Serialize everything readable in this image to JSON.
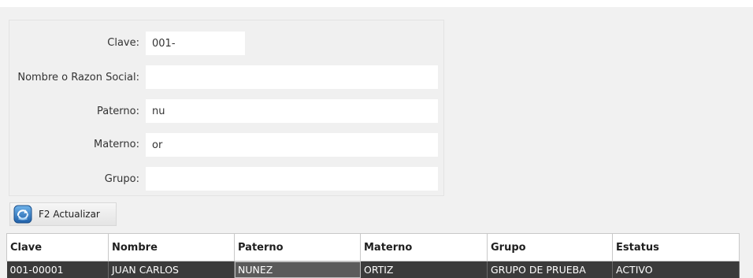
{
  "form": {
    "clave": {
      "label": "Clave:",
      "value": "001-"
    },
    "nombre": {
      "label": "Nombre o Razon Social:",
      "value": ""
    },
    "paterno": {
      "label": "Paterno:",
      "value": "nu"
    },
    "materno": {
      "label": "Materno:",
      "value": "or"
    },
    "grupo": {
      "label": "Grupo:",
      "value": ""
    }
  },
  "toolbar": {
    "refresh_label": "F2 Actualizar",
    "refresh_icon": "refresh-icon"
  },
  "table": {
    "columns": [
      "Clave",
      "Nombre",
      "Paterno",
      "Materno",
      "Grupo",
      "Estatus"
    ],
    "rows": [
      [
        "001-00001",
        "JUAN CARLOS",
        "NUNEZ",
        "ORTIZ",
        "GRUPO DE PRUEBA",
        "ACTIVO"
      ]
    ],
    "selected_row_bg": "#3b3b3b"
  }
}
